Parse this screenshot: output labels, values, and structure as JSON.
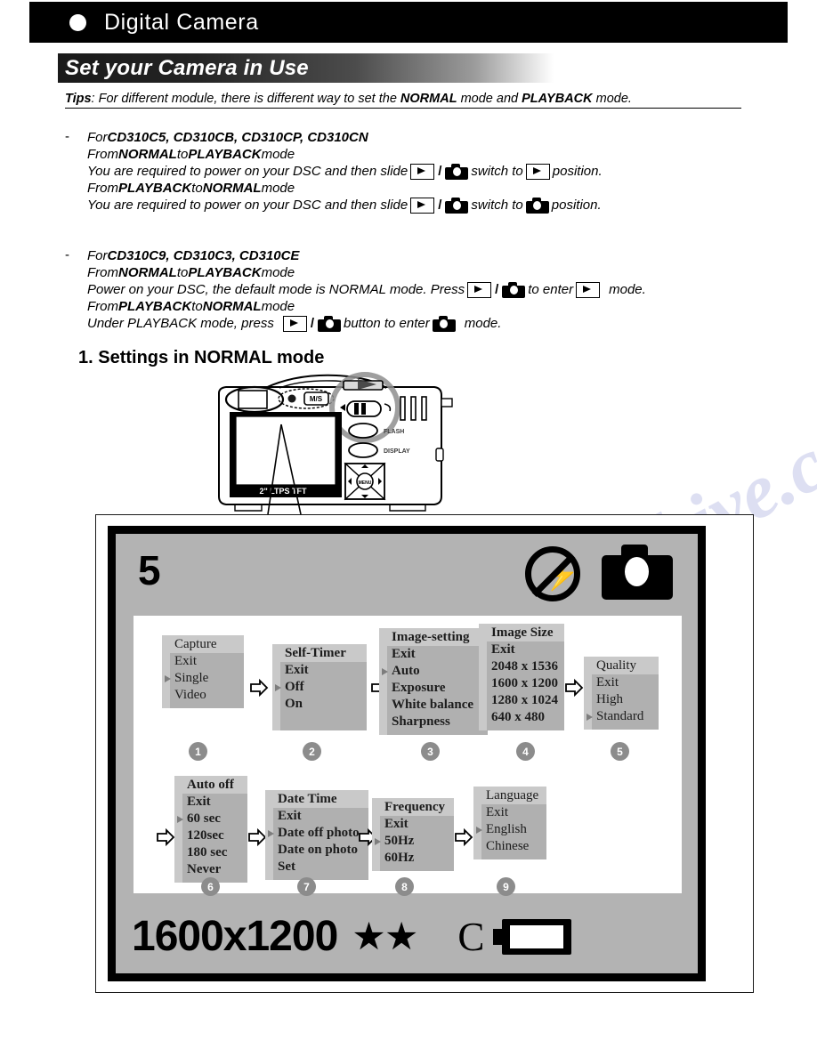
{
  "header": {
    "bullet_icon": "filled-circle-icon",
    "title": "Digital Camera"
  },
  "section": {
    "heading": "Set your Camera in Use"
  },
  "tips": {
    "label": "Tips",
    "colon": ":",
    "text_1": " For different module, there is different way to set the ",
    "bold_1": "NORMAL",
    "text_2": " mode and ",
    "bold_2": "PLAYBACK",
    "text_3": " mode."
  },
  "blocks": [
    {
      "dash": "-",
      "line1_pre": "For ",
      "line1_models": "CD310C5, CD310CB, CD310CP, CD310CN",
      "line2_pre": "From ",
      "line2_b1": "NORMAL",
      "line2_mid": " to ",
      "line2_b2": "PLAYBACK",
      "line2_post": " mode",
      "line3_pre": "You are required to power on your DSC and then slide ",
      "line3_mid": " switch to ",
      "line3_post": " position.",
      "line3_icon_a": "play-icon",
      "line3_icon_b": "camera-icon",
      "line3_icon_c": "play-icon",
      "line4_pre": "From ",
      "line4_b1": "PLAYBACK",
      "line4_mid": " to ",
      "line4_b2": "NORMAL",
      "line4_post": " mode",
      "line5_pre": "You are required to power on your DSC and then slide ",
      "line5_mid": " switch to ",
      "line5_post": " position.",
      "line5_icon_a": "play-icon",
      "line5_icon_b": "camera-icon",
      "line5_icon_c": "camera-icon"
    },
    {
      "dash": "-",
      "line1_pre": "For ",
      "line1_models": "CD310C9, CD310C3, CD310CE",
      "line2_pre": "From ",
      "line2_b1": "NORMAL",
      "line2_mid": " to ",
      "line2_b2": "PLAYBACK",
      "line2_post": " mode",
      "line3_pre": "Power on your DSC, the default mode is NORMAL mode. Press ",
      "line3_mid": " to enter ",
      "line3_post": " mode.",
      "line4_pre": "From ",
      "line4_b1": "PLAYBACK",
      "line4_mid": " to ",
      "line4_b2": "NORMAL",
      "line4_post": " mode",
      "line5_pre": "Under PLAYBACK mode, press ",
      "line5_mid": " button to enter ",
      "line5_post": " mode."
    }
  ],
  "numbered_heading": "1. Settings in NORMAL mode",
  "camera_illustration": {
    "screen_label": "2\" LTPS TFT",
    "button_flash": "FLASH",
    "button_display": "DISPLAY",
    "pad_center": "MENU",
    "mode_label": "M/S"
  },
  "lcd": {
    "top_counter": "5",
    "icon_no_flash": "no-flash-icon",
    "icon_camera_mode": "camera-mode-icon",
    "bottom_resolution": "1600x1200",
    "bottom_stars": "★★",
    "bottom_card": "C",
    "icon_battery": "battery-icon"
  },
  "menus": [
    {
      "num": "1",
      "title": "Capture",
      "items": [
        {
          "label": "Exit",
          "selected": false
        },
        {
          "label": "Single",
          "selected": true
        },
        {
          "label": "Video",
          "selected": false
        }
      ],
      "serif_plain": true
    },
    {
      "num": "2",
      "title": "Self-Timer",
      "items": [
        {
          "label": "Exit",
          "selected": false
        },
        {
          "label": "Off",
          "selected": true
        },
        {
          "label": "On",
          "selected": false
        }
      ],
      "serif_plain": false
    },
    {
      "num": "3",
      "title": "Image-setting",
      "items": [
        {
          "label": "Exit",
          "selected": false
        },
        {
          "label": "Auto",
          "selected": true
        },
        {
          "label": "Exposure",
          "selected": false
        },
        {
          "label": "White balance",
          "selected": false
        },
        {
          "label": "Sharpness",
          "selected": false
        }
      ],
      "serif_plain": false
    },
    {
      "num": "4",
      "title": "Image Size",
      "items": [
        {
          "label": "Exit",
          "selected": false
        },
        {
          "label": "2048 x 1536",
          "selected": false
        },
        {
          "label": "1600 x 1200",
          "selected": false
        },
        {
          "label": "1280 x 1024",
          "selected": false
        },
        {
          "label": "640 x 480",
          "selected": false
        }
      ],
      "serif_plain": false
    },
    {
      "num": "5",
      "title": "Quality",
      "items": [
        {
          "label": "Exit",
          "selected": false
        },
        {
          "label": "High",
          "selected": false
        },
        {
          "label": "Standard",
          "selected": true
        }
      ],
      "serif_plain": true
    },
    {
      "num": "6",
      "title": "Auto off",
      "items": [
        {
          "label": "Exit",
          "selected": false
        },
        {
          "label": "60 sec",
          "selected": true
        },
        {
          "label": "120sec",
          "selected": false
        },
        {
          "label": "180 sec",
          "selected": false
        },
        {
          "label": "Never",
          "selected": false
        }
      ],
      "serif_plain": false
    },
    {
      "num": "7",
      "title": "Date Time",
      "items": [
        {
          "label": "Exit",
          "selected": false
        },
        {
          "label": "Date off photo",
          "selected": true
        },
        {
          "label": "Date on photo",
          "selected": false
        },
        {
          "label": "Set",
          "selected": false
        }
      ],
      "serif_plain": false
    },
    {
      "num": "8",
      "title": "Frequency",
      "items": [
        {
          "label": "Exit",
          "selected": false
        },
        {
          "label": "50Hz",
          "selected": true
        },
        {
          "label": "60Hz",
          "selected": false
        }
      ],
      "serif_plain": false
    },
    {
      "num": "9",
      "title": "Language",
      "items": [
        {
          "label": "Exit",
          "selected": false
        },
        {
          "label": "English",
          "selected": true
        },
        {
          "label": "Chinese",
          "selected": false
        }
      ],
      "serif_plain": true
    }
  ],
  "watermark": "manualshive.com",
  "colors": {
    "header_bg": "#000000",
    "menu_title_bg": "#c9c9c9",
    "menu_body_bg": "#b0b0b0",
    "lcd_bg": "#b3b3b3",
    "num_circle": "#8c8c8c"
  }
}
